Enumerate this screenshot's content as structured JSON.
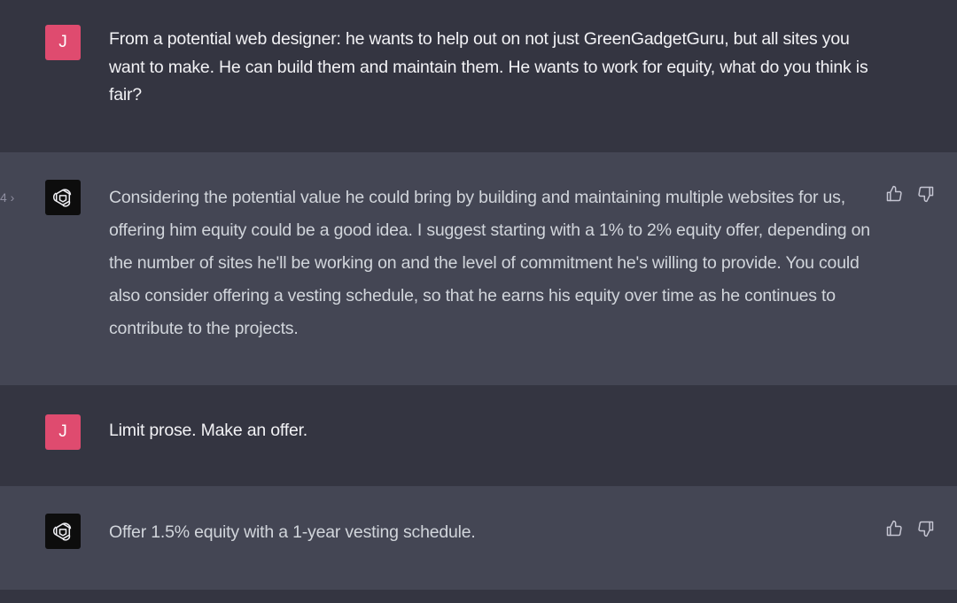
{
  "turns": [
    {
      "role": "user",
      "avatar_letter": "J",
      "text": "From a potential web designer: he wants to help out on not just GreenGadgetGuru, but all sites you want to make. He can build them and maintain them. He wants to work for equity, what do you think is fair?"
    },
    {
      "role": "assistant",
      "pager": "4 ›",
      "text": "Considering the potential value he could bring by building and maintaining multiple websites for us, offering him equity could be a good idea. I suggest starting with a 1% to 2% equity offer, depending on the number of sites he'll be working on and the level of commitment he's willing to provide. You could also consider offering a vesting schedule, so that he earns his equity over time as he continues to contribute to the projects."
    },
    {
      "role": "user",
      "avatar_letter": "J",
      "text": "Limit prose. Make an offer."
    },
    {
      "role": "assistant",
      "text": "Offer 1.5% equity with a 1-year vesting schedule."
    }
  ],
  "icons": {
    "assistant_avatar": "openai-logo-icon",
    "like": "thumbs-up-icon",
    "dislike": "thumbs-down-icon"
  },
  "colors": {
    "user_bg": "#343541",
    "assistant_bg": "#444654",
    "user_avatar": "#df4b6f",
    "assistant_avatar": "#0d0d0d"
  }
}
